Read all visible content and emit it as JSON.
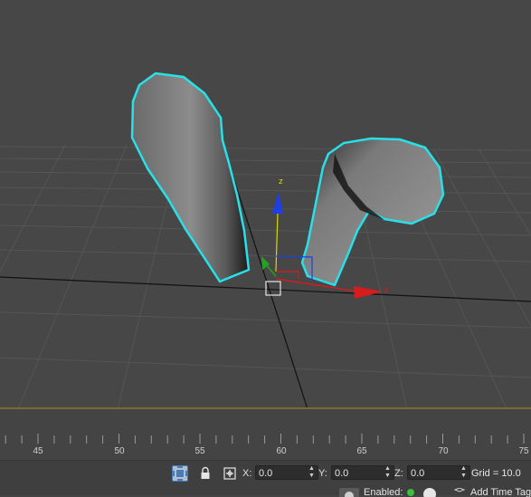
{
  "viewport": {
    "gizmo": {
      "z_label": "z",
      "x_label": "z"
    },
    "colors": {
      "background": "#474747",
      "grid": "#555555",
      "selection_outline": "#29e0e8",
      "x_axis": "#d61c1c",
      "y_axis": "#24a224",
      "z_axis": "#1f3ee6"
    }
  },
  "timeline": {
    "tick_labels": [
      "45",
      "50",
      "55",
      "60",
      "65",
      "70",
      "75"
    ]
  },
  "statusbar": {
    "icons": [
      "selection-lock-icon",
      "lock-icon",
      "absolute-mode-icon"
    ],
    "x_label": "X:",
    "x_value": "0.0",
    "y_label": "Y:",
    "y_value": "0.0",
    "z_label": "Z:",
    "z_value": "0.0",
    "grid_text": "Grid = 10.0",
    "enabled_text": "Enabled:",
    "add_time_tag_text": "Add Time Tag"
  }
}
